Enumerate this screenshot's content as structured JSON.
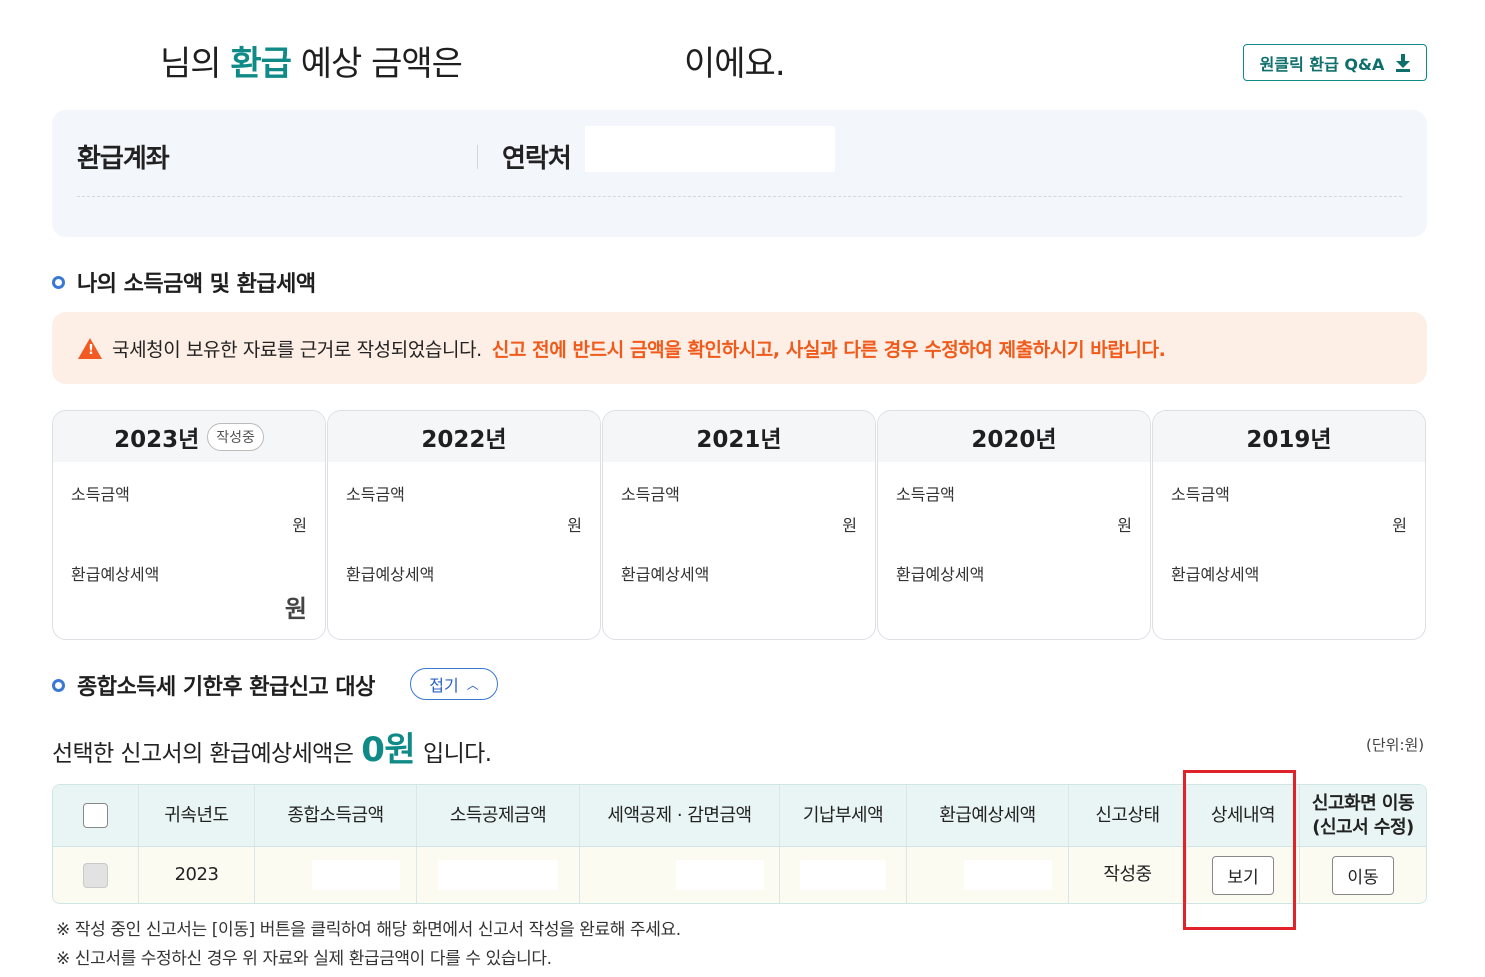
{
  "header": {
    "headline_prefix": "님의 ",
    "headline_accent": "환급",
    "headline_suffix": " 예상 금액은",
    "headline_tail": "이에요.",
    "qa_button": "원클릭 환급 Q&A"
  },
  "account": {
    "refund_account_label": "환급계좌",
    "contact_label": "연락처"
  },
  "income_section": {
    "title": "나의 소득금액 및 환급세액",
    "warning_text": "국세청이 보유한 자료를 근거로 작성되었습니다.",
    "warning_highlight": "신고 전에 반드시 금액을 확인하시고, 사실과 다른 경우 수정하여 제출하시기 바랍니다."
  },
  "years": [
    {
      "year": "2023년",
      "badge": "작성중",
      "income_label": "소득금액",
      "income_unit": "원",
      "refund_label": "환급예상세액",
      "refund_unit": "원"
    },
    {
      "year": "2022년",
      "income_label": "소득금액",
      "income_unit": "원",
      "refund_label": "환급예상세액"
    },
    {
      "year": "2021년",
      "income_label": "소득금액",
      "income_unit": "원",
      "refund_label": "환급예상세액"
    },
    {
      "year": "2020년",
      "income_label": "소득금액",
      "income_unit": "원",
      "refund_label": "환급예상세액"
    },
    {
      "year": "2019년",
      "income_label": "소득금액",
      "income_unit": "원",
      "refund_label": "환급예상세액"
    }
  ],
  "target_section": {
    "title": "종합소득세 기한후 환급신고 대상",
    "toggle_label": "접기",
    "summary_prefix": "선택한 신고서의 환급예상세액은",
    "summary_amount": "0원",
    "summary_suffix": "입니다.",
    "unit_note": "(단위:원)"
  },
  "table": {
    "headers": [
      "귀속년도",
      "종합소득금액",
      "소득공제금액",
      "세액공제 · 감면금액",
      "기납부세액",
      "환급예상세액",
      "신고상태",
      "상세내역",
      "신고화면 이동\n(신고서 수정)"
    ],
    "rows": [
      {
        "year": "2023",
        "status": "작성중",
        "detail_button": "보기",
        "move_button": "이동"
      }
    ]
  },
  "notes": [
    "※ 작성 중인 신고서는 [이동] 버튼을 클릭하여 해당 화면에서 신고서 작성을 완료해 주세요.",
    "※ 신고서를 수정하신 경우 위 자료와 실제 환급금액이 다를 수 있습니다."
  ],
  "colors": {
    "accent": "#0f8a87",
    "warning": "#f05a1a",
    "highlight_box": "#e0222a"
  }
}
